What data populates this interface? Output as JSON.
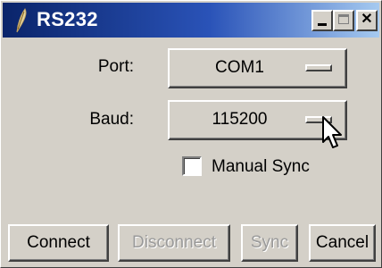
{
  "window": {
    "title": "RS232",
    "icons": {
      "app": "feather-icon",
      "minimize": "minimize-icon",
      "maximize": "maximize-icon",
      "close": "close-icon"
    },
    "close_glyph": "✕"
  },
  "form": {
    "port_label": "Port:",
    "port_value": "COM1",
    "baud_label": "Baud:",
    "baud_value": "115200",
    "manual_sync_label": "Manual Sync",
    "manual_sync_checked": false
  },
  "buttons": {
    "connect": "Connect",
    "disconnect": "Disconnect",
    "sync": "Sync",
    "cancel": "Cancel"
  },
  "colors": {
    "titlebar_start": "#0a246a",
    "titlebar_end": "#a6caf0",
    "face": "#d4d0c8",
    "disabled_text": "#9a9a9a"
  }
}
